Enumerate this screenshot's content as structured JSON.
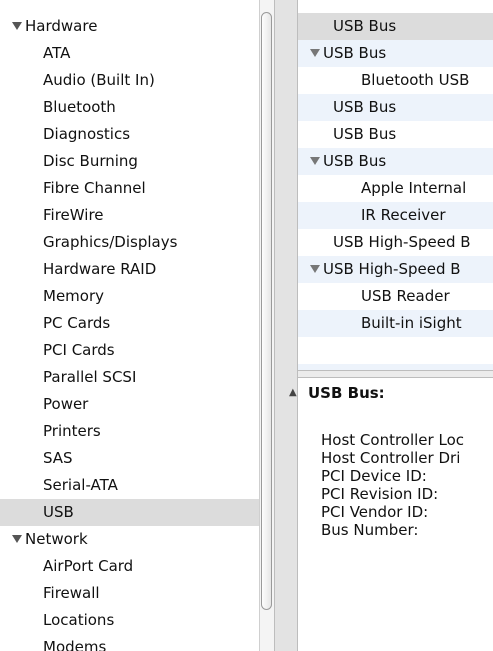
{
  "sidebar": {
    "categories": [
      {
        "label": "Hardware",
        "items": [
          "ATA",
          "Audio (Built In)",
          "Bluetooth",
          "Diagnostics",
          "Disc Burning",
          "Fibre Channel",
          "FireWire",
          "Graphics/Displays",
          "Hardware RAID",
          "Memory",
          "PC Cards",
          "PCI Cards",
          "Parallel SCSI",
          "Power",
          "Printers",
          "SAS",
          "Serial-ATA",
          "USB"
        ]
      },
      {
        "label": "Network",
        "items": [
          "AirPort Card",
          "Firewall",
          "Locations",
          "Modems"
        ]
      }
    ],
    "selected_item": "USB"
  },
  "usb_tree": {
    "rows": [
      {
        "label": "USB Bus",
        "level": 0,
        "expandable": false,
        "selected": true
      },
      {
        "label": "USB Bus",
        "level": 0,
        "expandable": true
      },
      {
        "label": "Bluetooth USB",
        "level": 1,
        "expandable": false
      },
      {
        "label": "USB Bus",
        "level": 0,
        "expandable": false
      },
      {
        "label": "USB Bus",
        "level": 0,
        "expandable": false
      },
      {
        "label": "USB Bus",
        "level": 0,
        "expandable": true
      },
      {
        "label": "Apple Internal",
        "level": 1,
        "expandable": false
      },
      {
        "label": "IR Receiver",
        "level": 1,
        "expandable": false
      },
      {
        "label": "USB High-Speed B",
        "level": 0,
        "expandable": false
      },
      {
        "label": "USB High-Speed B",
        "level": 0,
        "expandable": true
      },
      {
        "label": "USB Reader",
        "level": 1,
        "expandable": false
      },
      {
        "label": "Built-in iSight",
        "level": 1,
        "expandable": false
      }
    ]
  },
  "detail": {
    "title": "USB Bus:",
    "properties": [
      "Host Controller Loc",
      "Host Controller Dri",
      "PCI Device ID:",
      "PCI Revision ID:",
      "PCI Vendor ID:",
      "Bus Number:"
    ]
  },
  "icons": {
    "disclosure": "disclosure-triangle-icon",
    "splitter_caret": "splitter-caret-icon"
  },
  "colors": {
    "selection": "#dcdcdc",
    "alternate_row": "#edf3fb"
  }
}
